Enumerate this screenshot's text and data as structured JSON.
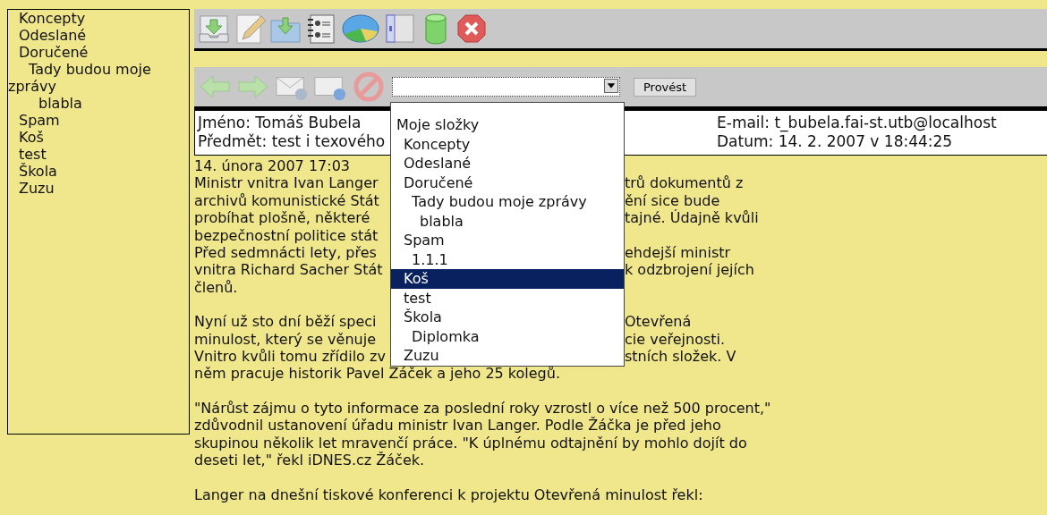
{
  "sidebar": {
    "items": [
      {
        "label": "Koncepty"
      },
      {
        "label": "Odeslané"
      },
      {
        "label": "Doručené",
        "children": [
          {
            "label": "Tady budou moje zprávy",
            "children": [
              {
                "label": "blabla"
              }
            ]
          }
        ]
      },
      {
        "label": "Spam"
      },
      {
        "label": "Koš"
      },
      {
        "label": "test"
      },
      {
        "label": "Škola"
      },
      {
        "label": "Zuzu"
      }
    ]
  },
  "folder_select": {
    "open": true,
    "button": "Provést",
    "options": [
      {
        "label": "Moje složky",
        "selected": false,
        "children": [
          {
            "label": "Koncepty",
            "selected": false
          },
          {
            "label": "Odeslané",
            "selected": false
          },
          {
            "label": "Doručené",
            "selected": false,
            "children": [
              {
                "label": "Tady budou moje zprávy",
                "selected": false,
                "children": [
                  {
                    "label": "blabla",
                    "selected": false
                  }
                ]
              }
            ]
          },
          {
            "label": "Spam",
            "selected": false,
            "children": [
              {
                "label": "1.1.1",
                "selected": false
              }
            ]
          },
          {
            "label": "Koš",
            "selected": true
          },
          {
            "label": "test",
            "selected": false
          },
          {
            "label": "Škola",
            "selected": false,
            "children": [
              {
                "label": "Diplomka",
                "selected": false
              }
            ]
          },
          {
            "label": "Zuzu",
            "selected": false
          }
        ]
      }
    ]
  },
  "header": {
    "name": "Jméno: Tomáš Bubela",
    "subject": "Předmět: test i texového",
    "email": "E-mail: t_bubela.fai-st.utb@localhost",
    "date": "Datum: 14. 2. 2007 v 18:44:25"
  },
  "message": {
    "date": "14. února 2007 17:03",
    "covered_paragraphs": [
      [
        {
          "left": "Ministr vnitra Ivan Langer",
          "right": "trů dokumentů z"
        },
        {
          "left": "archivů komunistické Stát",
          "right": "ění sice bude"
        },
        {
          "left": "probíhat plošně, některé",
          "right": "tajné. Údajně kvůli"
        },
        {
          "left": "bezpečnostní politice stát"
        },
        {
          "left": "Před sedmnácti lety, přes",
          "right": "ehdejší ministr"
        },
        {
          "left": "vnitra Richard Sacher Stát",
          "right": "k odzbrojení jejích"
        },
        {
          "left": "členů."
        }
      ],
      [
        {
          "left": "Nyní už sto dní běží speci",
          "right": "Otevřená"
        },
        {
          "left": "minulost, který se věnuje",
          "right": "cie veřejnosti."
        },
        {
          "left": "Vnitro kvůli tomu zřídilo zv",
          "right": "stních složek. V"
        },
        {
          "left": "něm pracuje historik Pavel Žáček a jeho 25 kolegů."
        }
      ]
    ],
    "paragraphs": [
      "\"Nárůst zájmu o tyto informace za poslední roky vzrostl o více než 500 procent,\" zdůvodnil ustanovení úřadu ministr Ivan Langer. Podle Žáčka je před jeho skupinou několik let mravenčí práce. \"K úplnému odtajnění by mohlo dojít do deseti let,\" řekl iDNES.cz Žáček.",
      "Langer na dnešní tiskové konferenci k projektu Otevřená minulost řekl:"
    ]
  }
}
